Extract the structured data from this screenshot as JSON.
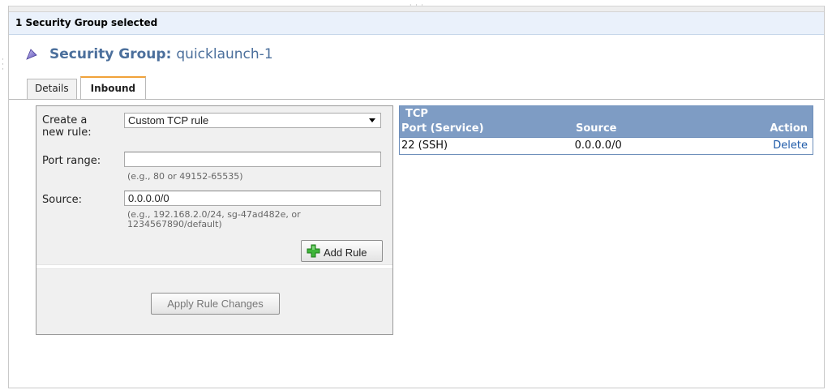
{
  "header": {
    "selection_text": "1 Security Group selected"
  },
  "title": {
    "label": "Security Group:",
    "value": "quicklaunch-1"
  },
  "tabs": [
    {
      "label": "Details",
      "active": false
    },
    {
      "label": "Inbound",
      "active": true
    }
  ],
  "form": {
    "create_rule_label_line1": "Create a",
    "create_rule_label_line2": "new rule:",
    "rule_type_selected": "Custom TCP rule",
    "port_range_label": "Port range:",
    "port_range_value": "",
    "port_range_hint": "(e.g., 80 or 49152-65535)",
    "source_label": "Source:",
    "source_value": "0.0.0.0/0",
    "source_hint_line1": "(e.g., 192.168.2.0/24, sg-47ad482e, or",
    "source_hint_line2": "1234567890/default)",
    "add_rule_label": "Add Rule",
    "apply_label": "Apply Rule Changes"
  },
  "rules_table": {
    "group_title": "TCP",
    "columns": [
      "Port (Service)",
      "Source",
      "Action"
    ],
    "rows": [
      {
        "port": "22 (SSH)",
        "source": "0.0.0.0/0",
        "action": "Delete"
      }
    ]
  },
  "colors": {
    "accent_tab": "#f0a23a",
    "title": "#4b6f9c",
    "table_header": "#7e9cc4",
    "link": "#1e5aa8"
  },
  "icons": [
    "security-group-icon",
    "plus-icon",
    "dropdown-caret-icon"
  ]
}
